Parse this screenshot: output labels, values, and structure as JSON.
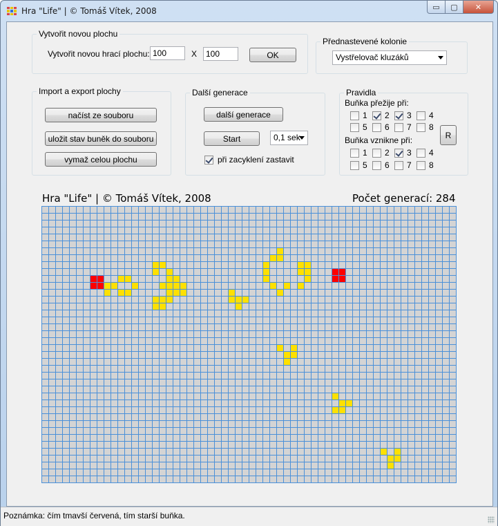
{
  "window": {
    "title": "Hra \"Life\" | © Tomáš Vítek, 2008",
    "min_glyph": "▭",
    "max_glyph": "▢",
    "close_glyph": "✕"
  },
  "new_board": {
    "group_label": "Vytvořit novou plochu",
    "prompt": "Vytvořit novou hrací plochu:",
    "width_value": "100",
    "times": "X",
    "height_value": "100",
    "ok_label": "OK"
  },
  "presets": {
    "group_label": "Přednastevené  kolonie",
    "selected": "Vystřelovač kluzáků"
  },
  "import_export": {
    "group_label": "Import a export plochy",
    "load_label": "načíst ze souboru",
    "save_label": "uložit stav buněk do souboru",
    "clear_label": "vymaž celou plochu"
  },
  "next_gen": {
    "group_label": "Další generace",
    "next_label": "další generace",
    "start_label": "Start",
    "speed_selected": "0,1 sek",
    "stop_on_loop_label": "při zacyklení zastavit",
    "stop_on_loop_checked": true
  },
  "rules": {
    "group_label": "Pravidla",
    "survive_label": "Buňka přežije při:",
    "survive": [
      {
        "n": "1",
        "checked": false
      },
      {
        "n": "2",
        "checked": true
      },
      {
        "n": "3",
        "checked": true
      },
      {
        "n": "4",
        "checked": false
      },
      {
        "n": "5",
        "checked": false
      },
      {
        "n": "6",
        "checked": false
      },
      {
        "n": "7",
        "checked": false
      },
      {
        "n": "8",
        "checked": false
      }
    ],
    "birth_label": "Buňka vznikne při:",
    "birth": [
      {
        "n": "1",
        "checked": false
      },
      {
        "n": "2",
        "checked": false
      },
      {
        "n": "3",
        "checked": true
      },
      {
        "n": "4",
        "checked": false
      },
      {
        "n": "5",
        "checked": false
      },
      {
        "n": "6",
        "checked": false
      },
      {
        "n": "7",
        "checked": false
      },
      {
        "n": "8",
        "checked": false
      }
    ],
    "reset_label": "R"
  },
  "board": {
    "caption": "Hra \"Life\" | © Tomáš Vítek, 2008",
    "generation_text": "Počet generací: 284",
    "columns": 60,
    "rows": 40,
    "colors": {
      "young": "#ffe000",
      "middle": "#ffc000",
      "old": "#ff0000",
      "dead": "#d4d4d4",
      "grid": "#4a90d9"
    },
    "cells": [
      [
        7,
        10,
        "old"
      ],
      [
        8,
        10,
        "old"
      ],
      [
        7,
        11,
        "old"
      ],
      [
        8,
        11,
        "old"
      ],
      [
        9,
        11,
        "young"
      ],
      [
        9,
        12,
        "young"
      ],
      [
        11,
        10,
        "young"
      ],
      [
        12,
        10,
        "young"
      ],
      [
        10,
        11,
        "young"
      ],
      [
        13,
        11,
        "young"
      ],
      [
        11,
        12,
        "young"
      ],
      [
        12,
        12,
        "young"
      ],
      [
        16,
        8,
        "young"
      ],
      [
        17,
        8,
        "young"
      ],
      [
        16,
        9,
        "young"
      ],
      [
        18,
        9,
        "young"
      ],
      [
        18,
        10,
        "young"
      ],
      [
        19,
        10,
        "young"
      ],
      [
        17,
        11,
        "young"
      ],
      [
        18,
        11,
        "young"
      ],
      [
        19,
        11,
        "young"
      ],
      [
        20,
        11,
        "young"
      ],
      [
        19,
        12,
        "young"
      ],
      [
        18,
        12,
        "young"
      ],
      [
        20,
        12,
        "young"
      ],
      [
        17,
        13,
        "young"
      ],
      [
        16,
        13,
        "young"
      ],
      [
        18,
        13,
        "young"
      ],
      [
        16,
        14,
        "young"
      ],
      [
        17,
        14,
        "young"
      ],
      [
        27,
        12,
        "young"
      ],
      [
        28,
        13,
        "young"
      ],
      [
        29,
        13,
        "young"
      ],
      [
        27,
        13,
        "young"
      ],
      [
        28,
        14,
        "young"
      ],
      [
        34,
        6,
        "young"
      ],
      [
        33,
        7,
        "young"
      ],
      [
        34,
        7,
        "young"
      ],
      [
        32,
        8,
        "young"
      ],
      [
        37,
        8,
        "young"
      ],
      [
        38,
        8,
        "young"
      ],
      [
        32,
        9,
        "young"
      ],
      [
        37,
        9,
        "young"
      ],
      [
        38,
        9,
        "young"
      ],
      [
        32,
        10,
        "young"
      ],
      [
        38,
        10,
        "young"
      ],
      [
        33,
        11,
        "young"
      ],
      [
        35,
        11,
        "young"
      ],
      [
        37,
        11,
        "young"
      ],
      [
        34,
        12,
        "young"
      ],
      [
        42,
        9,
        "old"
      ],
      [
        43,
        9,
        "old"
      ],
      [
        42,
        10,
        "old"
      ],
      [
        43,
        10,
        "old"
      ],
      [
        34,
        20,
        "young"
      ],
      [
        36,
        20,
        "young"
      ],
      [
        35,
        21,
        "young"
      ],
      [
        36,
        21,
        "young"
      ],
      [
        35,
        22,
        "young"
      ],
      [
        42,
        27,
        "young"
      ],
      [
        43,
        28,
        "young"
      ],
      [
        44,
        28,
        "young"
      ],
      [
        42,
        29,
        "young"
      ],
      [
        43,
        29,
        "young"
      ],
      [
        49,
        35,
        "young"
      ],
      [
        51,
        35,
        "young"
      ],
      [
        50,
        36,
        "young"
      ],
      [
        51,
        36,
        "young"
      ],
      [
        50,
        37,
        "young"
      ]
    ]
  },
  "status": {
    "text": "Poznámka: čím tmavší červená, tím starší buňka."
  }
}
